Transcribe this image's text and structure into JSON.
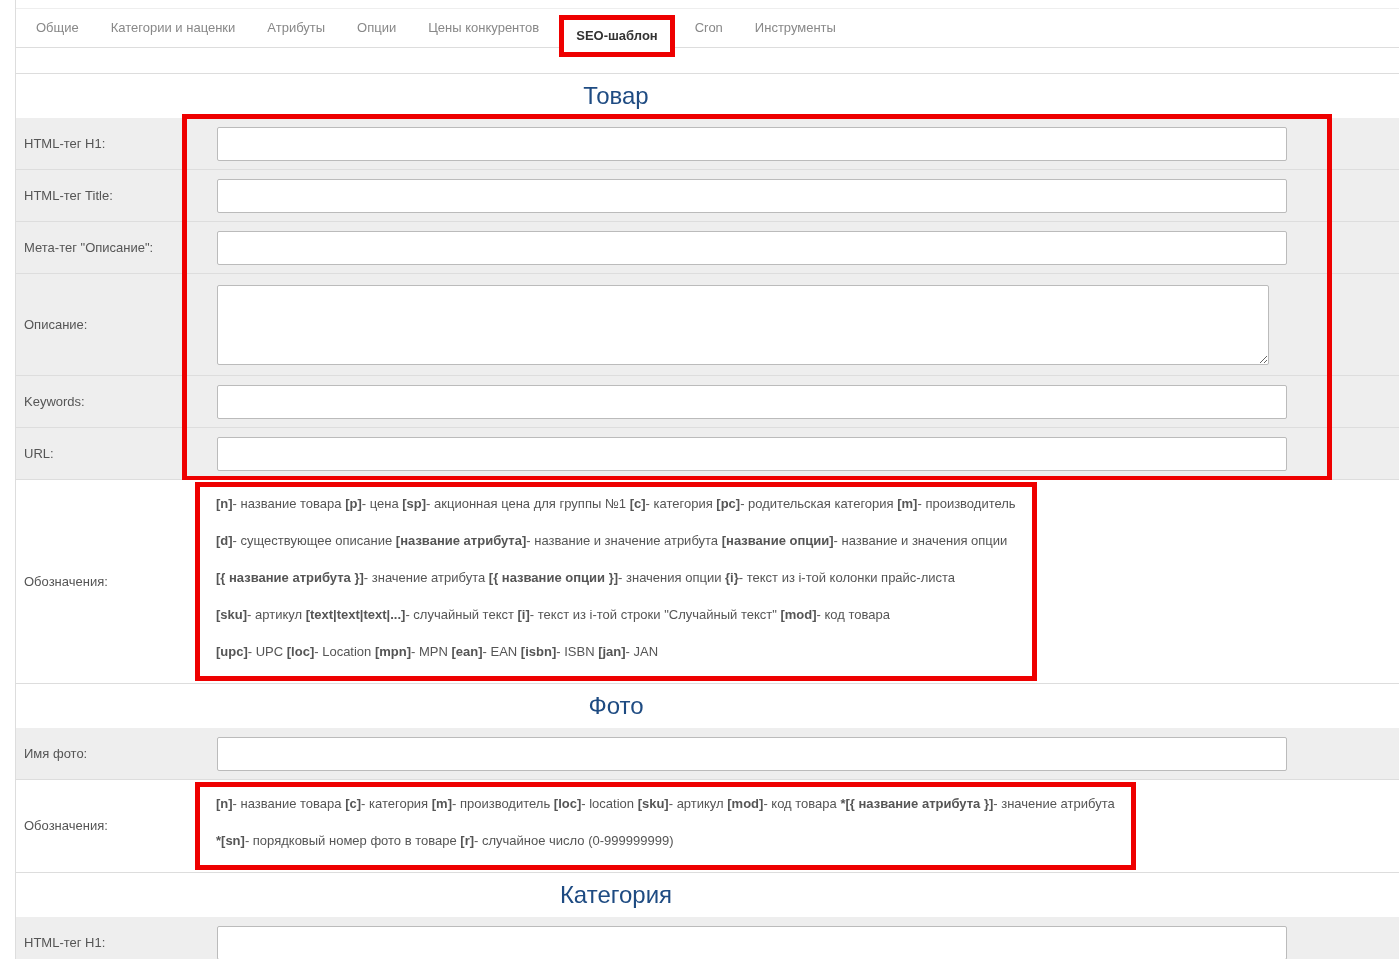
{
  "tabs": [
    {
      "label": "Общие",
      "selected": false,
      "highlighted": false
    },
    {
      "label": "Категории и наценки",
      "selected": false,
      "highlighted": false
    },
    {
      "label": "Атрибуты",
      "selected": false,
      "highlighted": false
    },
    {
      "label": "Опции",
      "selected": false,
      "highlighted": false
    },
    {
      "label": "Цены конкурентов",
      "selected": false,
      "highlighted": false
    },
    {
      "label": "SEO-шаблон",
      "selected": true,
      "highlighted": true
    },
    {
      "label": "Cron",
      "selected": false,
      "highlighted": false
    },
    {
      "label": "Инструменты",
      "selected": false,
      "highlighted": false
    }
  ],
  "sections": [
    {
      "title": "Товар",
      "groups": [
        {
          "highlighted": true,
          "rows": [
            {
              "kind": "input",
              "label": "HTML-тег H1:"
            },
            {
              "kind": "input",
              "label": "HTML-тег Title:"
            },
            {
              "kind": "input",
              "label": "Мета-тег \"Описание\":"
            },
            {
              "kind": "textarea",
              "label": "Описание:"
            },
            {
              "kind": "input",
              "label": "Keywords:"
            },
            {
              "kind": "input",
              "label": "URL:"
            }
          ]
        },
        {
          "highlighted": true,
          "rows": [
            {
              "kind": "legend",
              "label": "Обозначения:",
              "lines": [
                "**[n]**- название товара  **[p]**- цена  **[sp]**- акционная цена для группы №1  **[c]**- категория  **[pc]**- родительская категория **[m]**- производитель",
                "**[d]**- существующее описание  **[название атрибута]**- название и значение атрибута  **[название опции]**- название и значения опции",
                "**[{ название атрибута }]**- значение атрибута  **[{ название опции }]**- значения опции  **{i}**- текст из i-той колонки прайс-листа",
                "**[sku]**- артикул  **[text|text|text|...]**- случайный текст  **[i]**- текст из i-той строки \"Случайный текст\"  **[mod]**- код товара",
                "**[upc]**- UPC  **[loc]**- Location  **[mpn]**- MPN  **[ean]**- EAN  **[isbn]**- ISBN  **[jan]**- JAN"
              ]
            }
          ]
        }
      ]
    },
    {
      "title": "Фото",
      "groups": [
        {
          "highlighted": false,
          "rows": [
            {
              "kind": "input",
              "label": "Имя фото:"
            }
          ]
        },
        {
          "highlighted": true,
          "rows": [
            {
              "kind": "legend",
              "label": "Обозначения:",
              "lines": [
                "**[n]**- название товара  **[c]**- категория **[m]**- производитель  **[loc]**- location  **[sku]**- артикул  **[mod]**- код товара  ***[{ название атрибута }]**- значение атрибута",
                "***[sn]**- порядковый номер фото в товаре  **[r]**- случайное число (0-999999999)"
              ]
            }
          ]
        }
      ]
    },
    {
      "title": "Категория",
      "groups": [
        {
          "highlighted": false,
          "rows": [
            {
              "kind": "input",
              "label": "HTML-тег H1:"
            }
          ]
        }
      ]
    }
  ]
}
